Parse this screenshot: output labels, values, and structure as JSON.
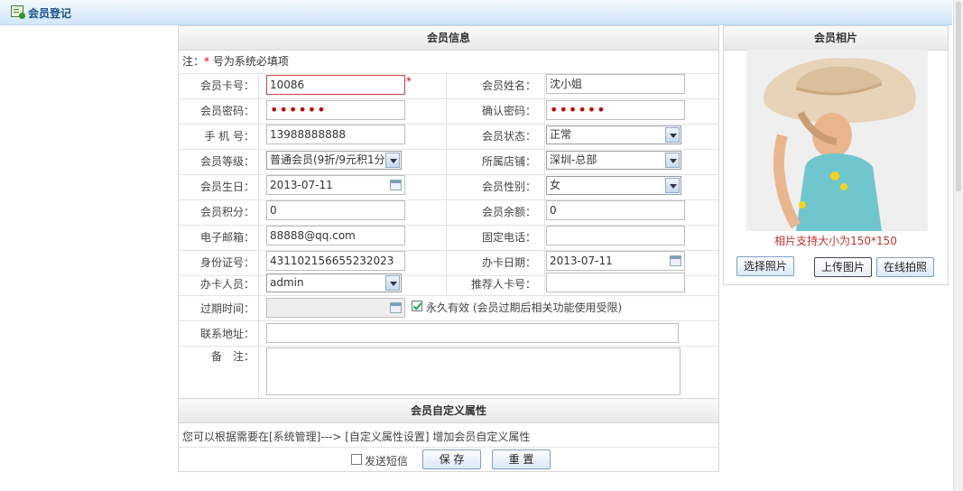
{
  "header": {
    "title": "会员登记"
  },
  "info": {
    "title": "会员信息",
    "note_prefix": "注：",
    "note_star": "*",
    "note_text": " 号为系统必填项",
    "required_mark": "*",
    "card_no": {
      "label": "会员卡号：",
      "value": "10086"
    },
    "name": {
      "label": "会员姓名：",
      "value": "沈小姐"
    },
    "password": {
      "label": "会员密码：",
      "value": "••••••"
    },
    "confirm": {
      "label": "确认密码：",
      "value": "••••••"
    },
    "phone": {
      "label": "手 机 号：",
      "value": "13988888888"
    },
    "status": {
      "label": "会员状态：",
      "value": "正常"
    },
    "level": {
      "label": "会员等级：",
      "value": "普通会员(9折/9元积1分"
    },
    "store": {
      "label": "所属店铺：",
      "value": "深圳-总部"
    },
    "birthday": {
      "label": "会员生日：",
      "value": "2013-07-11"
    },
    "gender": {
      "label": "会员性别：",
      "value": "女"
    },
    "points": {
      "label": "会员积分：",
      "value": "0"
    },
    "balance": {
      "label": "会员余额：",
      "value": "0"
    },
    "email": {
      "label": "电子邮箱：",
      "value": "88888@qq.com"
    },
    "tel": {
      "label": "固定电话：",
      "value": ""
    },
    "idcard": {
      "label": "身份证号：",
      "value": "431102156655232023"
    },
    "issue_date": {
      "label": "办卡日期：",
      "value": "2013-07-11"
    },
    "operator": {
      "label": "办卡人员：",
      "value": "admin"
    },
    "referrer": {
      "label": "推荐人卡号：",
      "value": ""
    },
    "expire": {
      "label": "过期时间：",
      "value": "",
      "forever_label": "永久有效 (会员过期后相关功能使用受限)",
      "forever_checked": true
    },
    "address": {
      "label": "联系地址：",
      "value": ""
    },
    "remark": {
      "label": "备　注：",
      "value": ""
    }
  },
  "custom": {
    "title": "会员自定义属性",
    "hint": "您可以根据需要在[系统管理]---> [自定义属性设置] 增加会员自定义属性"
  },
  "actions": {
    "sms_label": "发送短信",
    "save_label": "保 存",
    "reset_label": "重 置"
  },
  "photo": {
    "title": "会员相片",
    "tip": "相片支持大小为150*150",
    "choose_label": "选择照片",
    "upload_label": "上传图片",
    "capture_label": "在线拍照"
  }
}
